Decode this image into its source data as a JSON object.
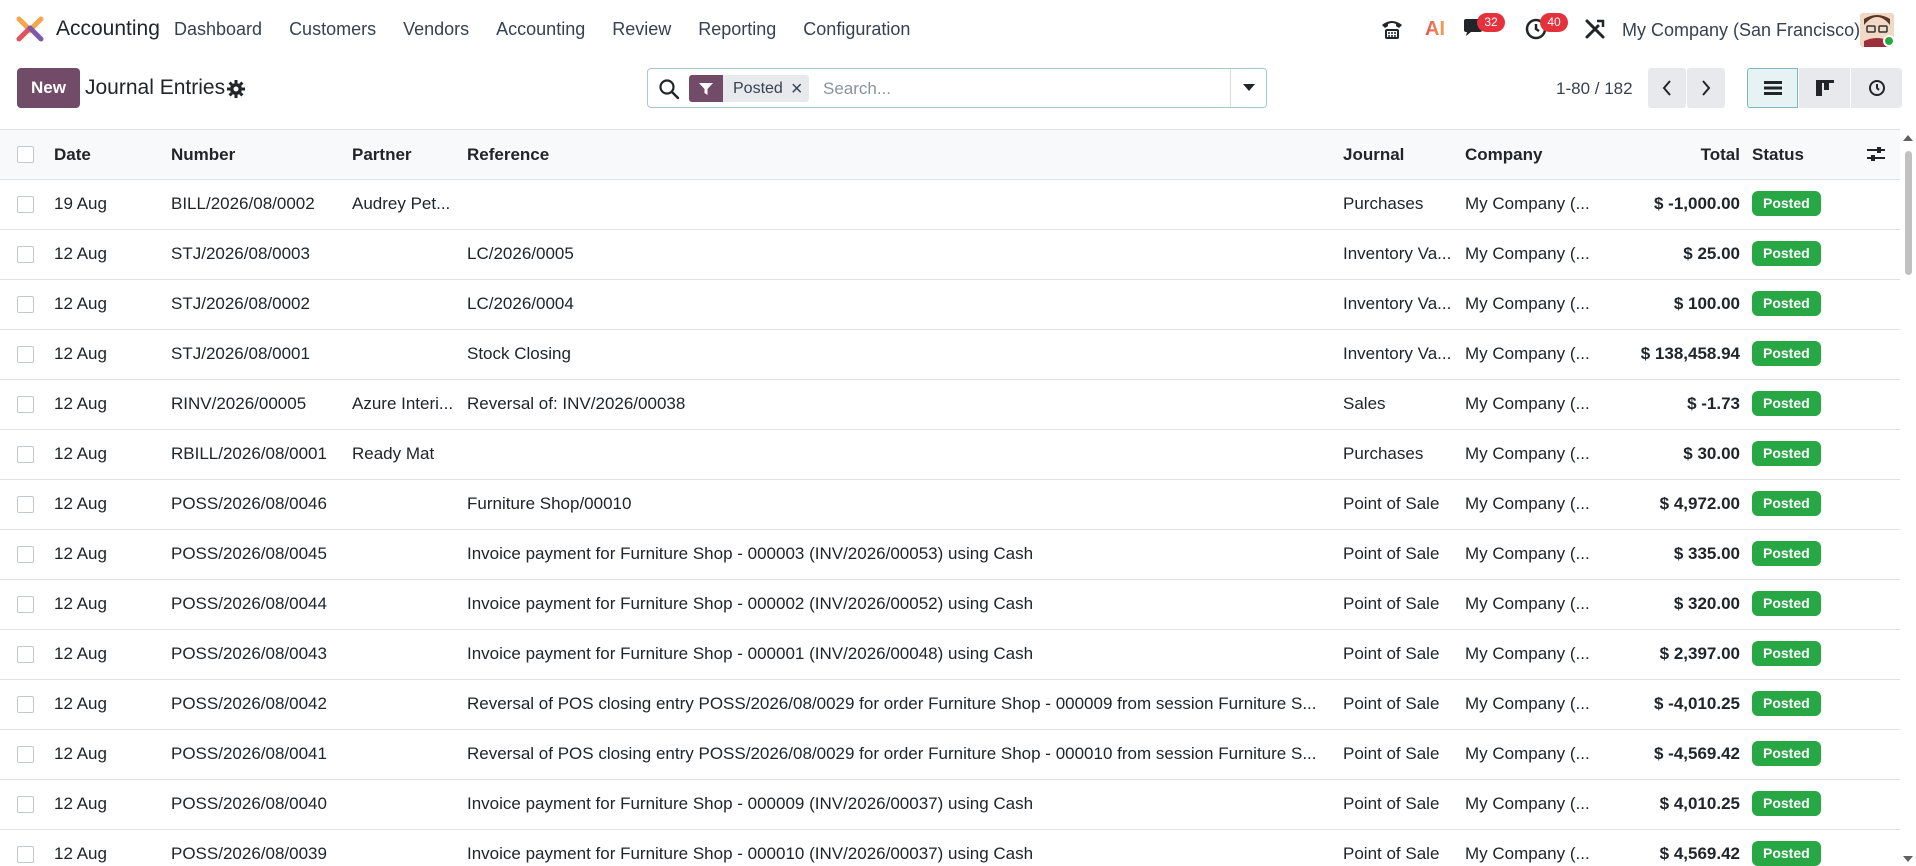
{
  "navbar": {
    "app_name": "Accounting",
    "menu": [
      "Dashboard",
      "Customers",
      "Vendors",
      "Accounting",
      "Review",
      "Reporting",
      "Configuration"
    ],
    "messages_count": "32",
    "activities_count": "40",
    "ai_label": "AI",
    "company": "My Company (San Francisco)"
  },
  "control_panel": {
    "new_label": "New",
    "breadcrumb": "Journal Entries",
    "facet": "Posted",
    "search_placeholder": "Search...",
    "pager": "1-80 / 182"
  },
  "list": {
    "columns": [
      "Date",
      "Number",
      "Partner",
      "Reference",
      "Journal",
      "Company",
      "Total",
      "Status"
    ],
    "rows": [
      {
        "date": "19 Aug",
        "number": "BILL/2026/08/0002",
        "partner": "Audrey Pet...",
        "reference": "",
        "journal": "Purchases",
        "company": "My Company (...",
        "total": "$ -1,000.00",
        "status": "Posted"
      },
      {
        "date": "12 Aug",
        "number": "STJ/2026/08/0003",
        "partner": "",
        "reference": "LC/2026/0005",
        "journal": "Inventory Va...",
        "company": "My Company (...",
        "total": "$ 25.00",
        "status": "Posted"
      },
      {
        "date": "12 Aug",
        "number": "STJ/2026/08/0002",
        "partner": "",
        "reference": "LC/2026/0004",
        "journal": "Inventory Va...",
        "company": "My Company (...",
        "total": "$ 100.00",
        "status": "Posted"
      },
      {
        "date": "12 Aug",
        "number": "STJ/2026/08/0001",
        "partner": "",
        "reference": "Stock Closing",
        "journal": "Inventory Va...",
        "company": "My Company (...",
        "total": "$ 138,458.94",
        "status": "Posted"
      },
      {
        "date": "12 Aug",
        "number": "RINV/2026/00005",
        "partner": "Azure Interi...",
        "reference": "Reversal of: INV/2026/00038",
        "journal": "Sales",
        "company": "My Company (...",
        "total": "$ -1.73",
        "status": "Posted"
      },
      {
        "date": "12 Aug",
        "number": "RBILL/2026/08/0001",
        "partner": "Ready Mat",
        "reference": "",
        "journal": "Purchases",
        "company": "My Company (...",
        "total": "$ 30.00",
        "status": "Posted"
      },
      {
        "date": "12 Aug",
        "number": "POSS/2026/08/0046",
        "partner": "",
        "reference": "Furniture Shop/00010",
        "journal": "Point of Sale",
        "company": "My Company (...",
        "total": "$ 4,972.00",
        "status": "Posted"
      },
      {
        "date": "12 Aug",
        "number": "POSS/2026/08/0045",
        "partner": "",
        "reference": "Invoice payment for Furniture Shop - 000003 (INV/2026/00053) using Cash",
        "journal": "Point of Sale",
        "company": "My Company (...",
        "total": "$ 335.00",
        "status": "Posted"
      },
      {
        "date": "12 Aug",
        "number": "POSS/2026/08/0044",
        "partner": "",
        "reference": "Invoice payment for Furniture Shop - 000002 (INV/2026/00052) using Cash",
        "journal": "Point of Sale",
        "company": "My Company (...",
        "total": "$ 320.00",
        "status": "Posted"
      },
      {
        "date": "12 Aug",
        "number": "POSS/2026/08/0043",
        "partner": "",
        "reference": "Invoice payment for Furniture Shop - 000001 (INV/2026/00048) using Cash",
        "journal": "Point of Sale",
        "company": "My Company (...",
        "total": "$ 2,397.00",
        "status": "Posted"
      },
      {
        "date": "12 Aug",
        "number": "POSS/2026/08/0042",
        "partner": "",
        "reference": "Reversal of POS closing entry POSS/2026/08/0029 for order Furniture Shop - 000009 from session Furniture S...",
        "journal": "Point of Sale",
        "company": "My Company (...",
        "total": "$ -4,010.25",
        "status": "Posted"
      },
      {
        "date": "12 Aug",
        "number": "POSS/2026/08/0041",
        "partner": "",
        "reference": "Reversal of POS closing entry POSS/2026/08/0029 for order Furniture Shop - 000010 from session Furniture S...",
        "journal": "Point of Sale",
        "company": "My Company (...",
        "total": "$ -4,569.42",
        "status": "Posted"
      },
      {
        "date": "12 Aug",
        "number": "POSS/2026/08/0040",
        "partner": "",
        "reference": "Invoice payment for Furniture Shop - 000009 (INV/2026/00037) using Cash",
        "journal": "Point of Sale",
        "company": "My Company (...",
        "total": "$ 4,010.25",
        "status": "Posted"
      },
      {
        "date": "12 Aug",
        "number": "POSS/2026/08/0039",
        "partner": "",
        "reference": "Invoice payment for Furniture Shop - 000010 (INV/2026/00037) using Cash",
        "journal": "Point of Sale",
        "company": "My Company (...",
        "total": "$ 4,569.42",
        "status": "Posted"
      }
    ]
  },
  "colors": {
    "brand": "#714b67",
    "status_posted": "#28a745",
    "badge": "#e4323c"
  }
}
